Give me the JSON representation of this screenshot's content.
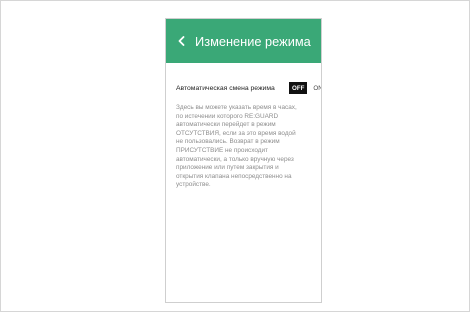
{
  "appbar": {
    "back_icon": "chevron-left-icon",
    "title": "Изменение режима"
  },
  "setting": {
    "label": "Автоматическая смена режима",
    "off_label": "OFF",
    "on_label": "ON",
    "state": "OFF"
  },
  "description": "Здесь вы можете указать время в часах,\nпо истечении которого RE:GUARD\nавтоматически перейдет в режим\nОТСУТСТВИЯ, если за это время водой\nне пользовались. Возврат в режим\nПРИСУТСТВИЕ не происходит\nавтоматически, а только вручную через\nприложение или путем закрытия и\nоткрытия клапана непосредственно на\nустройстве.",
  "colors": {
    "accent": "#3aa877",
    "toggle_off_bg": "#111111",
    "description_text": "#8e8e8e"
  }
}
